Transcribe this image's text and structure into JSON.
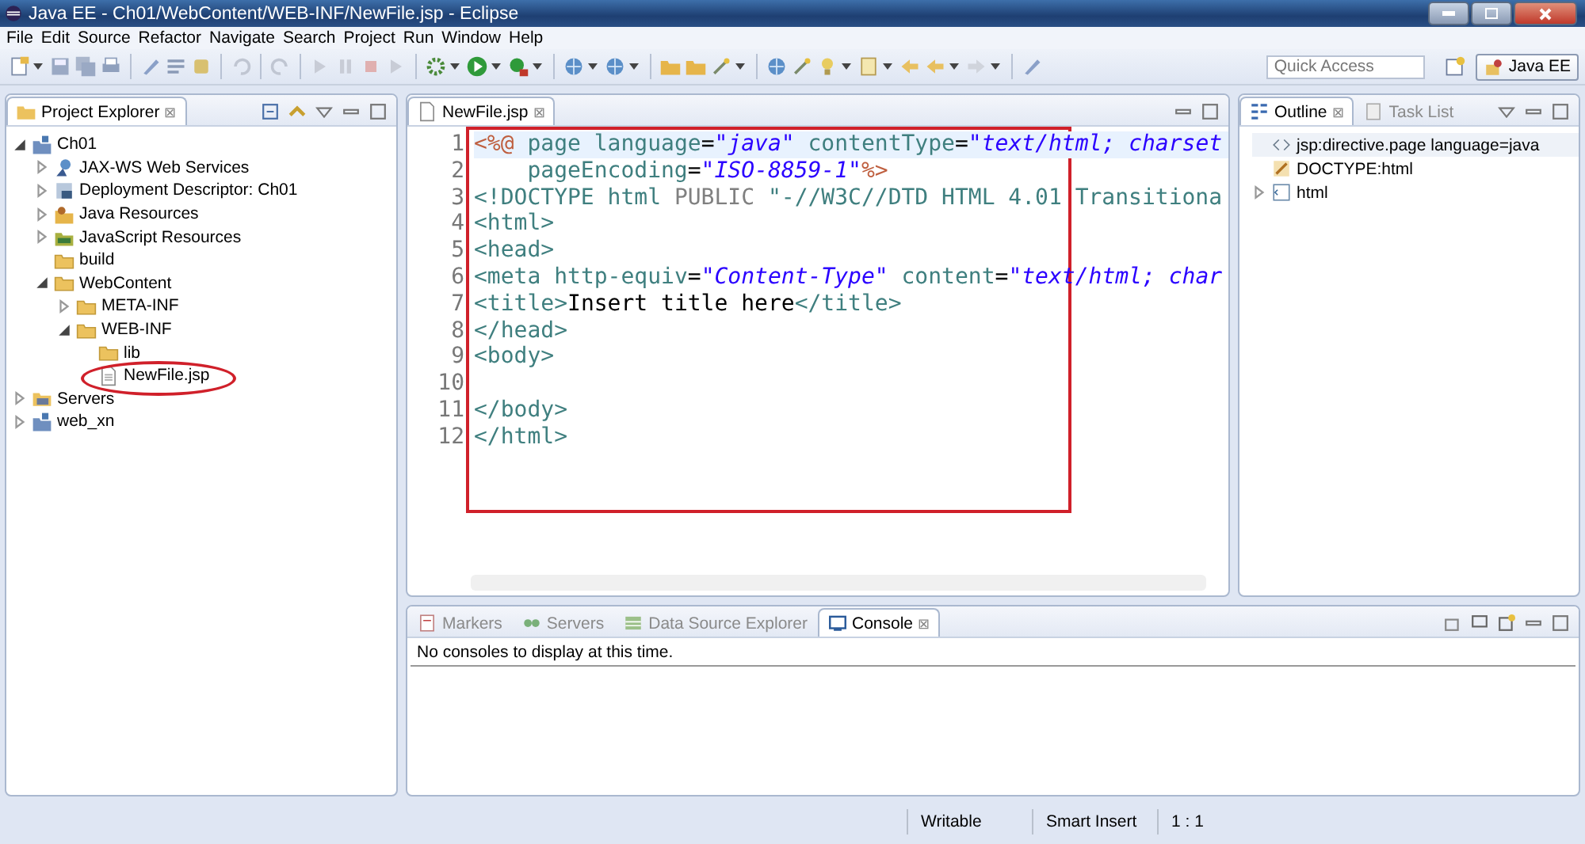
{
  "window": {
    "title": "Java EE - Ch01/WebContent/WEB-INF/NewFile.jsp - Eclipse"
  },
  "menu": [
    "File",
    "Edit",
    "Source",
    "Refactor",
    "Navigate",
    "Search",
    "Project",
    "Run",
    "Window",
    "Help"
  ],
  "toolbar": {
    "quick_access": {
      "placeholder": "Quick Access"
    },
    "perspective": {
      "label": "Java EE",
      "selected": true
    }
  },
  "project_explorer": {
    "tab": {
      "label": "Project Explorer",
      "close": "⊠"
    },
    "tree": [
      {
        "label": "Ch01",
        "kind": "project",
        "expanded": true,
        "children": [
          {
            "label": "JAX-WS Web Services",
            "kind": "service",
            "expanded": false
          },
          {
            "label": "Deployment Descriptor: Ch01",
            "kind": "descriptor",
            "expanded": false
          },
          {
            "label": "Java Resources",
            "kind": "java",
            "expanded": false
          },
          {
            "label": "JavaScript Resources",
            "kind": "javascript",
            "expanded": false
          },
          {
            "label": "build",
            "kind": "folder"
          },
          {
            "label": "WebContent",
            "kind": "folder",
            "expanded": true,
            "children": [
              {
                "label": "META-INF",
                "kind": "folder",
                "expanded": false
              },
              {
                "label": "WEB-INF",
                "kind": "folder",
                "expanded": true,
                "children": [
                  {
                    "label": "lib",
                    "kind": "folder"
                  },
                  {
                    "label": "NewFile.jsp",
                    "kind": "file"
                  }
                ]
              }
            ]
          }
        ]
      },
      {
        "label": "Servers",
        "kind": "servers",
        "expanded": false
      },
      {
        "label": "web_xn",
        "kind": "project",
        "expanded": false
      }
    ]
  },
  "editor": {
    "tab": {
      "label": "NewFile.jsp",
      "close": "⊠"
    },
    "lines": [
      {
        "number": "1",
        "segments": [
          {
            "kind": "delim",
            "text": "<%@"
          },
          {
            "kind": "attr",
            "text": " page language"
          },
          {
            "kind": "punct",
            "text": "="
          },
          {
            "kind": "string",
            "text": "\"java\""
          },
          {
            "kind": "attr",
            "text": " contentType"
          },
          {
            "kind": "punct",
            "text": "="
          },
          {
            "kind": "string",
            "text": "\"text/html; charset"
          }
        ]
      },
      {
        "number": "2",
        "segments": [
          {
            "kind": "attr",
            "text": "    pageEncoding"
          },
          {
            "kind": "punct",
            "text": "="
          },
          {
            "kind": "string",
            "text": "\"ISO-8859-1\""
          },
          {
            "kind": "delim",
            "text": "%>"
          }
        ]
      },
      {
        "number": "3",
        "segments": [
          {
            "kind": "tag",
            "text": "<!DOCTYPE"
          },
          {
            "kind": "attr",
            "text": " html"
          },
          {
            "kind": "doc",
            "text": " PUBLIC"
          },
          {
            "kind": "attr",
            "text": " \"-//W3C//DTD HTML 4.01 Transitiona"
          }
        ]
      },
      {
        "number": "4",
        "segments": [
          {
            "kind": "tag",
            "text": "<html>"
          }
        ]
      },
      {
        "number": "5",
        "segments": [
          {
            "kind": "tag",
            "text": "<head>"
          }
        ]
      },
      {
        "number": "6",
        "segments": [
          {
            "kind": "tag",
            "text": "<meta"
          },
          {
            "kind": "attr",
            "text": " http-equiv"
          },
          {
            "kind": "punct",
            "text": "="
          },
          {
            "kind": "string",
            "text": "\"Content-Type\""
          },
          {
            "kind": "attr",
            "text": " content"
          },
          {
            "kind": "punct",
            "text": "="
          },
          {
            "kind": "string",
            "text": "\"text/html; char"
          }
        ]
      },
      {
        "number": "7",
        "segments": [
          {
            "kind": "tag",
            "text": "<title>"
          },
          {
            "kind": "text",
            "text": "Insert title here"
          },
          {
            "kind": "tag",
            "text": "</title>"
          }
        ]
      },
      {
        "number": "8",
        "segments": [
          {
            "kind": "tag",
            "text": "</head>"
          }
        ]
      },
      {
        "number": "9",
        "segments": [
          {
            "kind": "tag",
            "text": "<body>"
          }
        ]
      },
      {
        "number": "10"
      },
      {
        "number": "11",
        "segments": [
          {
            "kind": "tag",
            "text": "</body>"
          }
        ]
      },
      {
        "number": "12",
        "segments": [
          {
            "kind": "tag",
            "text": "</html>"
          }
        ]
      }
    ]
  },
  "outline": {
    "tabs": [
      {
        "label": "Outline",
        "selected": true,
        "close": "⊠"
      },
      {
        "label": "Task List",
        "selected": false
      }
    ],
    "items": [
      {
        "label": "jsp:directive.page language=java",
        "kind": "directive",
        "selected": true
      },
      {
        "label": "DOCTYPE:html",
        "kind": "doctype",
        "selected": false
      },
      {
        "label": "html",
        "kind": "element",
        "selected": false,
        "expanded": false
      }
    ]
  },
  "bottom_panel": {
    "tabs": [
      {
        "label": "Markers",
        "kind": "markers",
        "selected": false
      },
      {
        "label": "Servers",
        "kind": "servers",
        "selected": false
      },
      {
        "label": "Data Source Explorer",
        "kind": "datasource",
        "selected": false
      },
      {
        "label": "Console",
        "kind": "console",
        "selected": true,
        "close": "⊠"
      }
    ],
    "message": "No consoles to display at this time."
  },
  "status_bar": [
    "Writable",
    "Smart Insert",
    "1 : 1"
  ]
}
